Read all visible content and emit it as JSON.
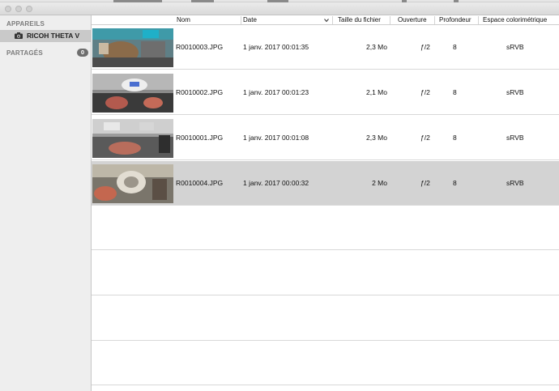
{
  "sidebar": {
    "devices_header": "APPAREILS",
    "device_name": "RICOH THETA V",
    "shared_header": "PARTAGÉS",
    "shared_count": "0"
  },
  "table": {
    "columns": {
      "name": "Nom",
      "date": "Date",
      "size": "Taille du fichier",
      "aperture": "Ouverture",
      "depth": "Profondeur",
      "colorspace": "Espace colorimétrique"
    },
    "rows": [
      {
        "name": "R0010003.JPG",
        "date": "1 janv. 2017 00:01:35",
        "size": "2,3 Mo",
        "aperture": "ƒ/2",
        "depth": "8",
        "colorspace": "sRVB"
      },
      {
        "name": "R0010002.JPG",
        "date": "1 janv. 2017 00:01:23",
        "size": "2,1 Mo",
        "aperture": "ƒ/2",
        "depth": "8",
        "colorspace": "sRVB"
      },
      {
        "name": "R0010001.JPG",
        "date": "1 janv. 2017 00:01:08",
        "size": "2,3 Mo",
        "aperture": "ƒ/2",
        "depth": "8",
        "colorspace": "sRVB"
      },
      {
        "name": "R0010004.JPG",
        "date": "1 janv. 2017 00:00:32",
        "size": "2 Mo",
        "aperture": "ƒ/2",
        "depth": "8",
        "colorspace": "sRVB"
      }
    ],
    "selected_row": 4
  },
  "icons": {
    "camera": "camera-icon",
    "sort": "chevron-down-icon"
  }
}
